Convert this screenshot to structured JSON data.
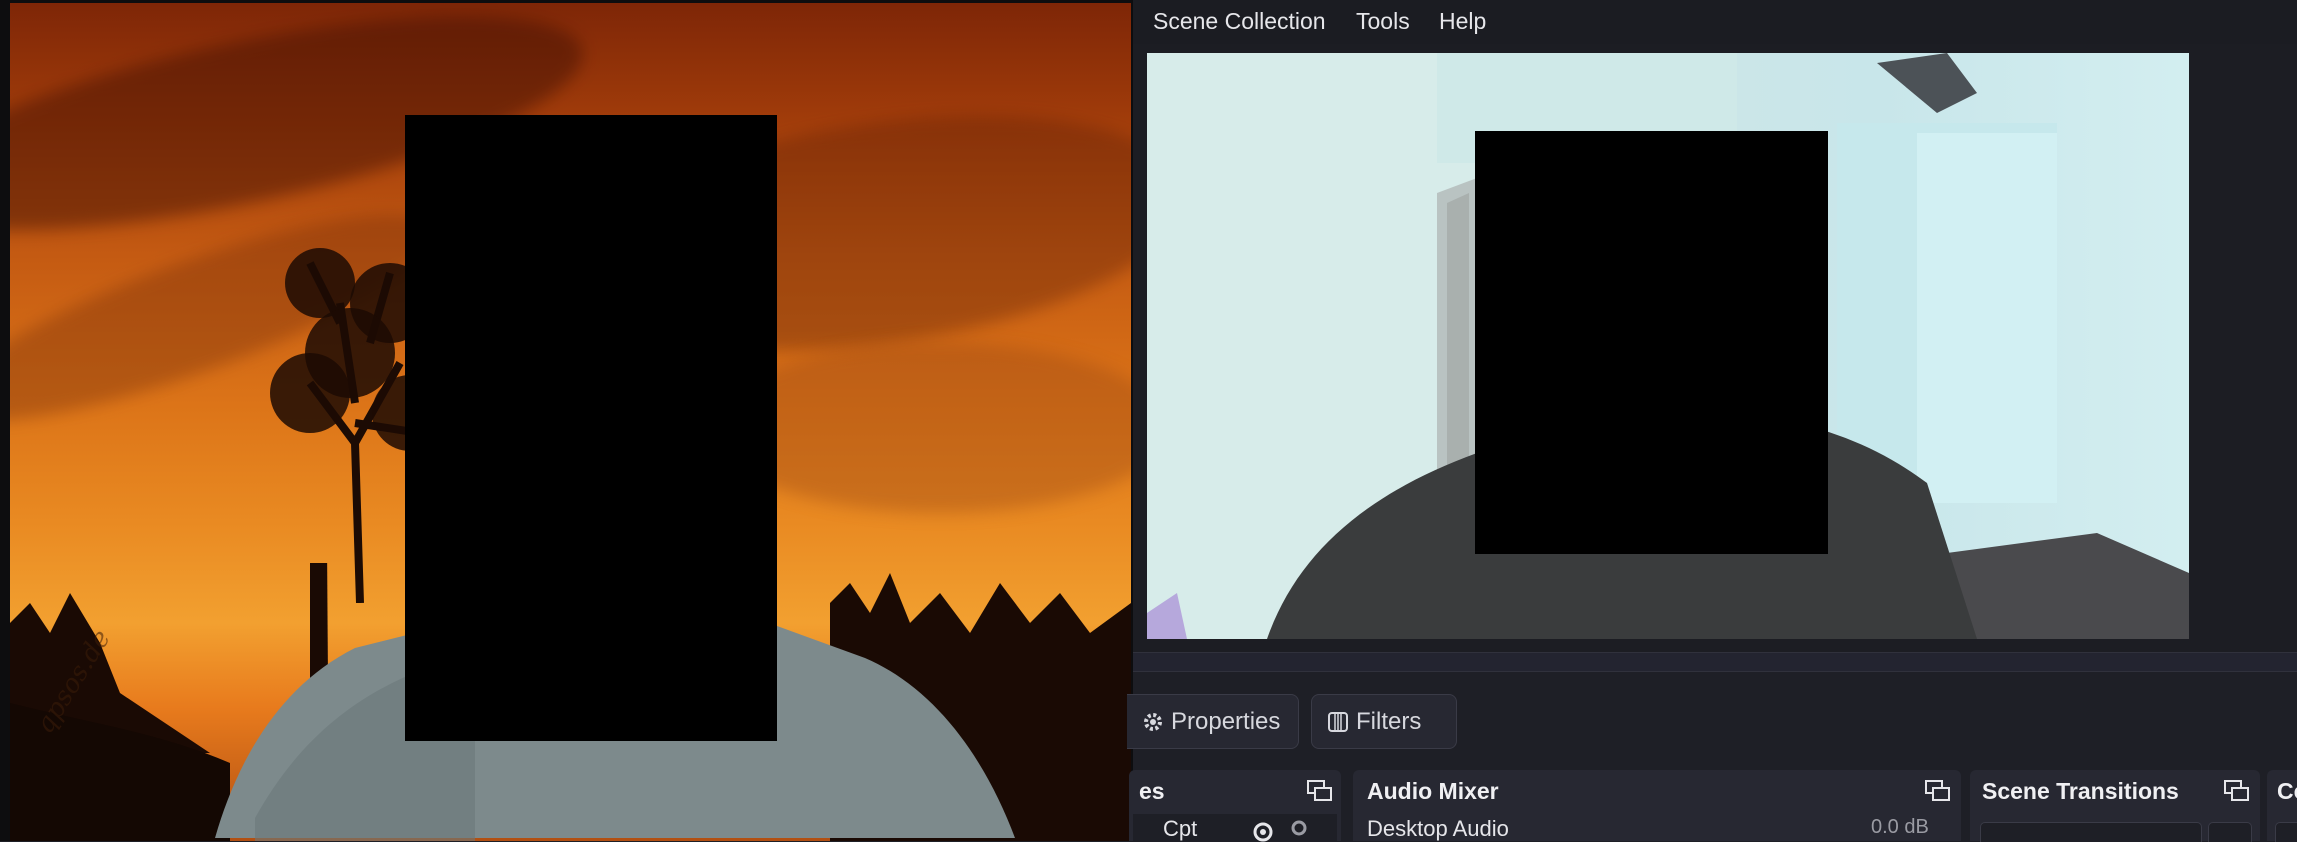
{
  "menu": {
    "items": [
      "Scene Collection",
      "Tools",
      "Help"
    ]
  },
  "projector": {
    "watermark": "qpsos.de"
  },
  "source_toolbar": {
    "properties_label": "Properties",
    "filters_label": "Filters"
  },
  "docks": {
    "sources": {
      "title": "es",
      "row_label": "Cpt"
    },
    "audio_mixer": {
      "title": "Audio Mixer",
      "channel": "Desktop Audio",
      "level": "0.0 dB"
    },
    "scene_transitions": {
      "title": "Scene Transitions"
    },
    "controls": {
      "title": "Co"
    }
  },
  "colors": {
    "bg": "#1e1f26",
    "dock": "#272832",
    "text": "#e6e6ea"
  }
}
